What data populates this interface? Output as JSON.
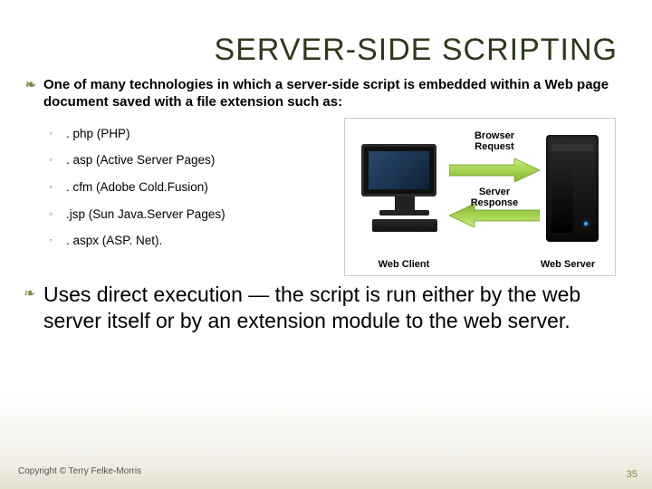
{
  "title": "SERVER-SIDE  SCRIPTING",
  "intro": "One of many technologies in which a server-side script is embedded within a Web page document saved with a file extension such as:",
  "extensions": {
    "i0": ". php (PHP)",
    "i1": ". asp (Active Server Pages)",
    "i2": ". cfm (Adobe Cold.Fusion)",
    "i3": ".jsp (Sun Java.Server Pages)",
    "i4": ". aspx (ASP. Net)."
  },
  "uses": "Uses direct execution — the script is run either by the web server itself or by an extension module to the web server.",
  "diagram": {
    "browser_request": "Browser Request",
    "server_response": "Server Response",
    "web_client": "Web Client",
    "web_server": "Web Server"
  },
  "copyright": "Copyright © Terry Felke-Morris",
  "page_number": "35"
}
